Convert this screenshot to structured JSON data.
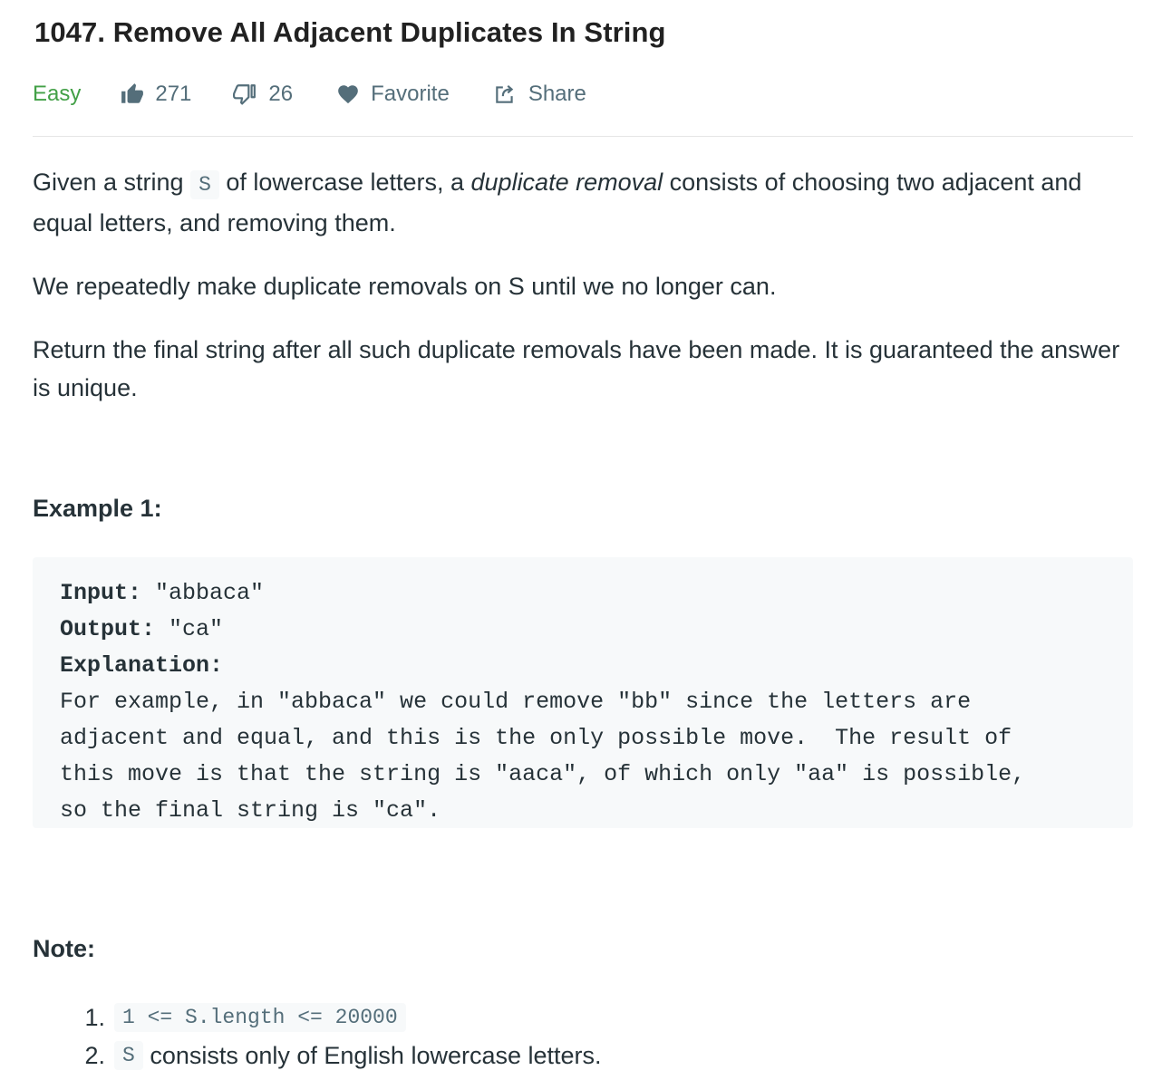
{
  "problem": {
    "title": "1047. Remove All Adjacent Duplicates In String",
    "difficulty": "Easy",
    "likes": "271",
    "dislikes": "26",
    "favorite_label": "Favorite",
    "share_label": "Share"
  },
  "description": {
    "p1_part1": "Given a string ",
    "p1_code": "S",
    "p1_part2": " of lowercase letters, a ",
    "p1_em": "duplicate removal",
    "p1_part3": " consists of choosing two adjacent and equal letters, and removing them.",
    "p2": "We repeatedly make duplicate removals on S until we no longer can.",
    "p3": "Return the final string after all such duplicate removals have been made.  It is guaranteed the answer is unique."
  },
  "example": {
    "title": "Example 1:",
    "input_label": "Input:",
    "input_value": " \"abbaca\"",
    "output_label": "Output:",
    "output_value": " \"ca\"",
    "explanation_label": "Explanation:",
    "explanation_lines": [
      "For example, in \"abbaca\" we could remove \"bb\" since the letters are",
      "adjacent and equal, and this is the only possible move.  The result of",
      "this move is that the string is \"aaca\", of which only \"aa\" is possible,",
      "so the final string is \"ca\"."
    ]
  },
  "note": {
    "title": "Note:",
    "items": [
      {
        "number": "1.",
        "code": "1 <= S.length <= 20000",
        "text": ""
      },
      {
        "number": "2.",
        "code": "S",
        "text": " consists only of English lowercase letters."
      }
    ]
  },
  "colors": {
    "easy": "#43a047",
    "meta_text": "#546e7a",
    "code_background": "#f7f9fa"
  },
  "icons": [
    "thumbs-up-icon",
    "thumbs-down-icon",
    "heart-icon",
    "share-icon"
  ]
}
